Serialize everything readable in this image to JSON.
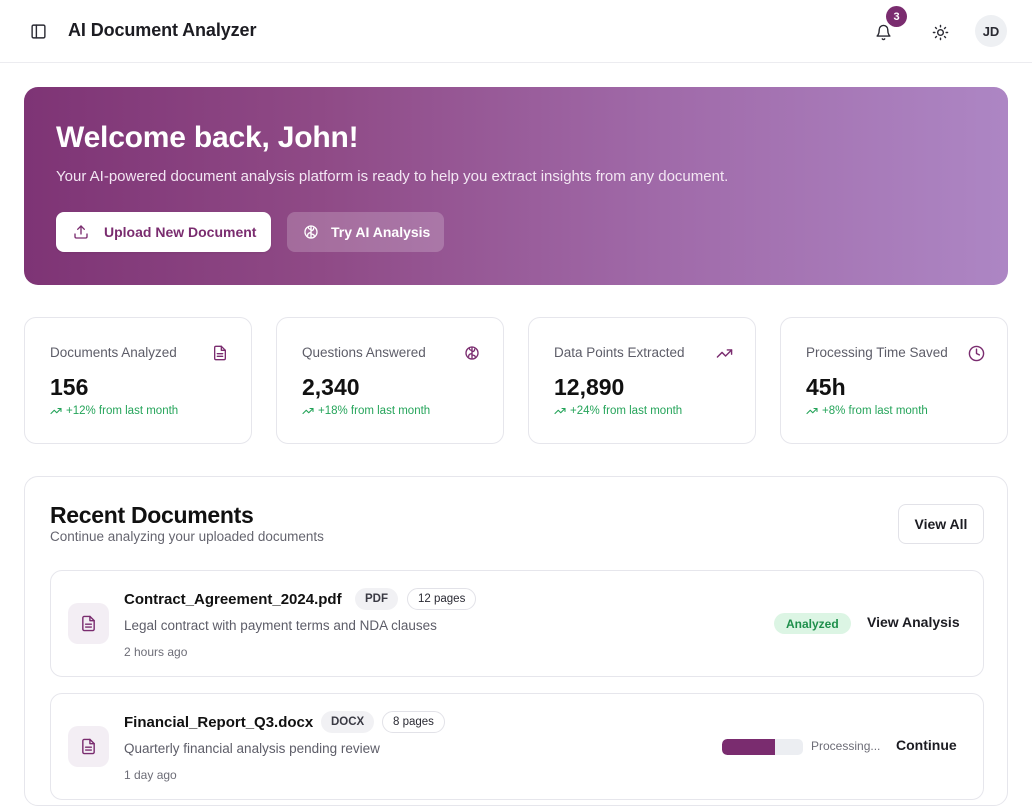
{
  "header": {
    "title": "AI Document Analyzer",
    "notification_count": "3",
    "user_initials": "JD"
  },
  "hero": {
    "title": "Welcome back, John!",
    "subtitle": "Your AI-powered document analysis platform is ready to help you extract insights from any document.",
    "upload_label": "Upload New Document",
    "try_label": "Try AI Analysis"
  },
  "stats": [
    {
      "label": "Documents Analyzed",
      "value": "156",
      "trend": "+12% from last month",
      "icon": "file-text-icon"
    },
    {
      "label": "Questions Answered",
      "value": "2,340",
      "trend": "+18% from last month",
      "icon": "brain-icon"
    },
    {
      "label": "Data Points Extracted",
      "value": "12,890",
      "trend": "+24% from last month",
      "icon": "trending-up-icon"
    },
    {
      "label": "Processing Time Saved",
      "value": "45h",
      "trend": "+8% from last month",
      "icon": "clock-icon"
    }
  ],
  "recent": {
    "title": "Recent Documents",
    "subtitle": "Continue analyzing your uploaded documents",
    "view_all_label": "View All",
    "documents": [
      {
        "name": "Contract_Agreement_2024.pdf",
        "type": "PDF",
        "pages": "12 pages",
        "description": "Legal contract with payment terms and NDA clauses",
        "time": "2 hours ago",
        "status": "Analyzed",
        "action": "View Analysis"
      },
      {
        "name": "Financial_Report_Q3.docx",
        "type": "DOCX",
        "pages": "8 pages",
        "description": "Quarterly financial analysis pending review",
        "time": "1 day ago",
        "status": "Processing...",
        "progress_percent": 65,
        "action": "Continue"
      }
    ]
  },
  "colors": {
    "brand": "#7a2c6f",
    "success": "#25a45a",
    "success_bg": "#dcf5e4"
  }
}
